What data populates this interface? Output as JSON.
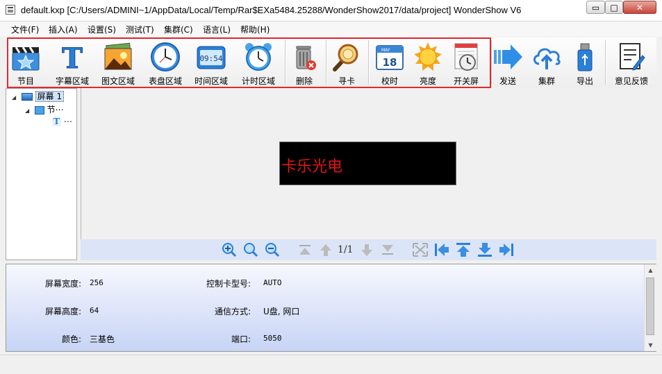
{
  "window": {
    "title": "default.kxp [C:/Users/ADMINI~1/AppData/Local/Temp/Rar$EXa5484.25288/WonderShow2017/data/project] WonderShow V6",
    "min_glyph": "▭",
    "max_glyph": "□",
    "close_glyph": "✕"
  },
  "menu": [
    "文件(F)",
    "插入(A)",
    "设置(S)",
    "测试(T)",
    "集群(C)",
    "语言(L)",
    "帮助(H)"
  ],
  "toolbar": {
    "program": "节目",
    "subtitle_area": "字幕区域",
    "image_text_area": "图文区域",
    "clock_area": "表盘区域",
    "time_area": "时间区域",
    "timer_area": "计时区域",
    "delete": "删除",
    "find_card": "寻卡",
    "time_sync": "校时",
    "brightness": "亮度",
    "power_switch": "开关屏",
    "send": "发送",
    "cluster": "集群",
    "export": "导出",
    "feedback": "意见反馈",
    "digital_time": "09:54",
    "calendar_day": "18",
    "calendar_month": "MAY",
    "subtitle_glyph": "T"
  },
  "tree": {
    "screen": "屏幕 1",
    "program": "节⋯",
    "text_item": "⋯",
    "text_icon": "T"
  },
  "canvas": {
    "led_text": "卡乐光电",
    "led_text_color": "#e01515",
    "pager": "1/1"
  },
  "props": {
    "width_label": "屏幕宽度:",
    "width_value": "256",
    "height_label": "屏幕高度:",
    "height_value": "64",
    "color_label": "颜色:",
    "color_value": "三基色",
    "card_label": "控制卡型号:",
    "card_value": "AUTO",
    "comm_label": "通信方式:",
    "comm_value": "U盘, 网口",
    "port_label": "端口:",
    "port_value": "5050"
  },
  "colors": {
    "highlight": "#e3272d",
    "accent_blue": "#2a7fd8",
    "panel": "#c7d4f6"
  }
}
